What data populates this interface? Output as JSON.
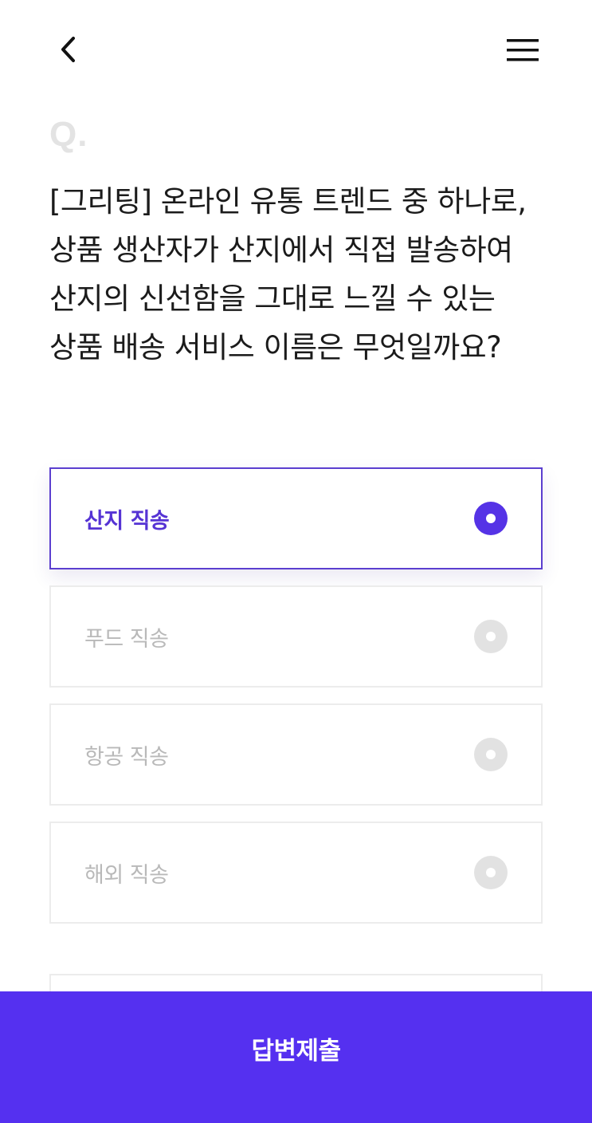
{
  "header": {
    "back_icon": "chevron-left-icon",
    "menu_icon": "hamburger-menu-icon"
  },
  "quiz": {
    "q_marker": "Q.",
    "question": "[그리팅] 온라인 유통 트렌드 중 하나로, 상품 생산자가 산지에서 직접 발송하여 산지의 신선함을 그대로 느낄 수 있는 상품 배송 서비스 이름은 무엇일까요?",
    "options": [
      {
        "label": "산지 직송",
        "selected": true
      },
      {
        "label": "푸드 직송",
        "selected": false
      },
      {
        "label": "항공 직송",
        "selected": false
      },
      {
        "label": "해외 직송",
        "selected": false
      }
    ],
    "submit_label": "답변제출"
  },
  "colors": {
    "accent": "#5530f0",
    "selected_border": "#5b3fcf",
    "selected_text": "#5533d4",
    "unselected_text": "#b9b9b9",
    "unselected_radio": "#e2e2e2"
  }
}
